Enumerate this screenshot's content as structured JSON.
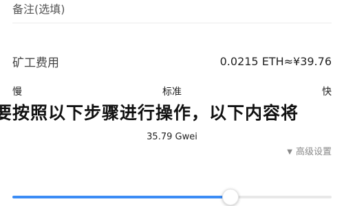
{
  "remark": {
    "label": "备注(选填)"
  },
  "fee": {
    "label": "矿工费用",
    "value": "0.0215 ETH≈¥39.76"
  },
  "speed": {
    "slow": "慢",
    "standard": "标准",
    "fast": "快",
    "level": 0.68
  },
  "gas": {
    "value": "35.79 Gwei"
  },
  "advanced": {
    "label": "高级设置",
    "arrow_icon": "triangle-down-icon"
  },
  "overlay": {
    "text": "要按照以下步骤进行操作，以下内容将"
  },
  "colors": {
    "accent": "#3b8cf5",
    "track": "#e8e8e8"
  }
}
